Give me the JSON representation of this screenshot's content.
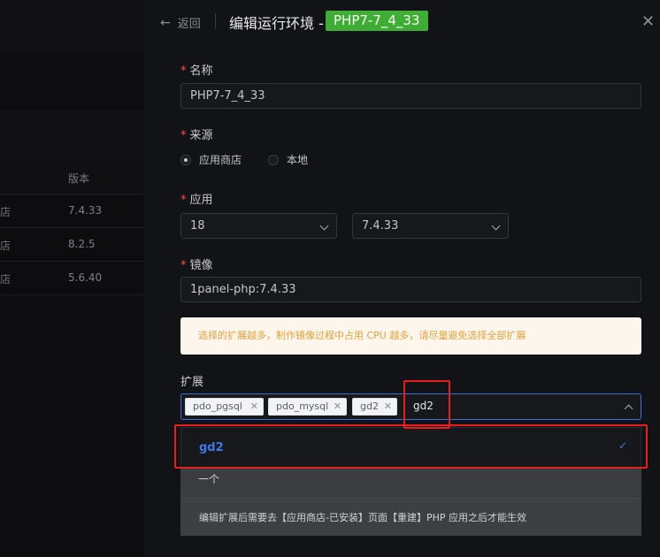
{
  "background_table": {
    "column_version": "版本",
    "rows": [
      {
        "source_fragment": "店",
        "version": "7.4.33"
      },
      {
        "source_fragment": "店",
        "version": "8.2.5"
      },
      {
        "source_fragment": "店",
        "version": "5.6.40"
      }
    ]
  },
  "drawer": {
    "back_label": "返回",
    "title": "编辑运行环境 -",
    "title_tag": "PHP7-7_4_33",
    "tag_color": "#3dae33",
    "close_icon": "close-icon"
  },
  "form": {
    "name": {
      "label": "名称",
      "value": "PHP7-7_4_33"
    },
    "source": {
      "label": "来源",
      "options": [
        {
          "label": "应用商店",
          "selected": true
        },
        {
          "label": "本地",
          "selected": false
        }
      ]
    },
    "app": {
      "label": "应用",
      "app_value": "18",
      "version_value": "7.4.33"
    },
    "image": {
      "label": "镜像",
      "value": "1panel-php:7.4.33"
    },
    "warning": "选择的扩展越多，制作镜像过程中占用 CPU 越多，请尽量避免选择全部扩展",
    "extensions": {
      "label": "扩展",
      "chips": [
        "pdo_pgsql",
        "pdo_mysql",
        "gd2"
      ],
      "typed_value": "gd2",
      "dropdown_option": "gd2"
    },
    "ghost_text_1": "一个",
    "ghost_text_2": "编辑扩展后需要去【应用商店-已安装】页面【重建】PHP 应用之后才能生效"
  },
  "colors": {
    "accent": "#3d78e8",
    "required": "#ff4d4f",
    "highlight": "#e81e1e",
    "warning_text": "#e6a23c",
    "warning_bg": "#fdf6ec"
  }
}
